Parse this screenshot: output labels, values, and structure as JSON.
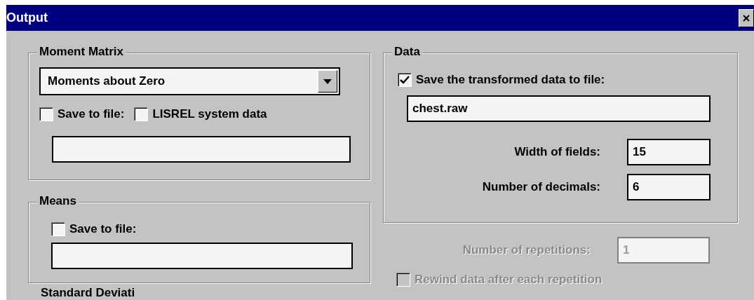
{
  "window": {
    "title": "Output"
  },
  "moment_matrix": {
    "title": "Moment Matrix",
    "combo": {
      "value": "Moments about Zero"
    },
    "checkboxes": [
      {
        "label": "Save to file:",
        "checked": false
      },
      {
        "label": "LISREL system data",
        "checked": false
      }
    ]
  },
  "means": {
    "title": "Means",
    "checkbox": {
      "label": "Save to file:",
      "checked": false
    }
  },
  "data": {
    "title": "Data",
    "checkbox": {
      "label": "Save the transformed data to file:",
      "checked": true
    },
    "file": {
      "value": "chest.raw"
    },
    "fields": [
      {
        "label": "Width of fields:",
        "value": "15",
        "disabled": false
      },
      {
        "label": "Number of decimals:",
        "value": "6",
        "disabled": false
      }
    ]
  },
  "repetitions": {
    "label": "Number of repetitions:",
    "value": "1",
    "disabled": true
  },
  "rewind": {
    "label": "Rewind data after each repetition",
    "checked": false,
    "disabled": true
  },
  "standard_deviations": {
    "title": "Standard Deviati"
  }
}
